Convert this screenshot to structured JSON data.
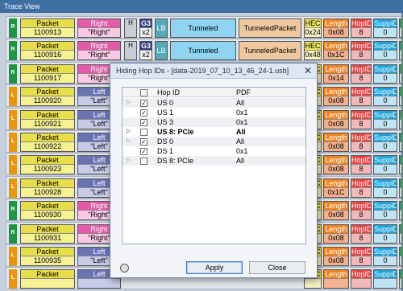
{
  "window": {
    "title": "Trace View"
  },
  "rows": [
    {
      "dir": "R",
      "packet": "1100913",
      "direction": "Right",
      "direction_val": "\"Right\"",
      "hv": "H",
      "g3": "G3",
      "g3_val": "x2",
      "lb": "LB",
      "tunneled": "Tunneled",
      "tunneled_packet": "TunneledPacket",
      "hec_h": "HEC",
      "hec": "0x24",
      "len_h": "Length",
      "len": "0x08",
      "hop_h": "HopID",
      "hop": "8",
      "sup_h": "SuppID",
      "sup": "0",
      "pl_h": "P",
      "pl": ""
    },
    {
      "dir": "R",
      "packet": "1100916",
      "direction": "Right",
      "direction_val": "\"Right\"",
      "hv": "H",
      "g3": "G3",
      "g3_val": "x2",
      "lb": "LB",
      "tunneled": "Tunneled",
      "tunneled_packet": "TunneledPacket",
      "hec_h": "HEC",
      "hec": "0x48",
      "len_h": "Length",
      "len": "0x1C",
      "hop_h": "HopID",
      "hop": "8",
      "sup_h": "SuppID",
      "sup": "0",
      "pl_h": "P",
      "pl": ""
    },
    {
      "dir": "R",
      "packet": "1100917",
      "direction": "Right",
      "direction_val": "\"Right\"",
      "hv": "",
      "g3": "",
      "g3_val": "",
      "lb": "",
      "tunneled": "",
      "tunneled_packet": "",
      "hec_h": "HEC",
      "hec": "",
      "len_h": "Length",
      "len": "0x14",
      "hop_h": "HopID",
      "hop": "8",
      "sup_h": "SuppID",
      "sup": "0",
      "pl_h": "P",
      "pl": ""
    },
    {
      "dir": "L",
      "packet": "1100920",
      "direction": "Left",
      "direction_val": "\"Left\"",
      "hv": "",
      "g3": "",
      "g3_val": "",
      "lb": "",
      "tunneled": "",
      "tunneled_packet": "",
      "hec_h": "HEC",
      "hec": "",
      "len_h": "Length",
      "len": "0x08",
      "hop_h": "HopID",
      "hop": "8",
      "sup_h": "SuppID",
      "sup": "0",
      "pl_h": "P",
      "pl": ""
    },
    {
      "dir": "L",
      "packet": "1100921",
      "direction": "Left",
      "direction_val": "\"Left\"",
      "hv": "",
      "g3": "",
      "g3_val": "",
      "lb": "",
      "tunneled": "",
      "tunneled_packet": "",
      "hec_h": "HEC",
      "hec": "",
      "len_h": "Length",
      "len": "0x08",
      "hop_h": "HopID",
      "hop": "8",
      "sup_h": "SuppID",
      "sup": "0",
      "pl_h": "P",
      "pl": ""
    },
    {
      "dir": "L",
      "packet": "1100922",
      "direction": "Left",
      "direction_val": "\"Left\"",
      "hv": "",
      "g3": "",
      "g3_val": "",
      "lb": "",
      "tunneled": "",
      "tunneled_packet": "",
      "hec_h": "HEC",
      "hec": "",
      "len_h": "Length",
      "len": "0x08",
      "hop_h": "HopID",
      "hop": "8",
      "sup_h": "SuppID",
      "sup": "0",
      "pl_h": "P",
      "pl": ""
    },
    {
      "dir": "L",
      "packet": "1100923",
      "direction": "Left",
      "direction_val": "\"Left\"",
      "hv": "",
      "g3": "",
      "g3_val": "",
      "lb": "",
      "tunneled": "",
      "tunneled_packet": "",
      "hec_h": "HEC",
      "hec": "",
      "len_h": "Length",
      "len": "0x08",
      "hop_h": "HopID",
      "hop": "8",
      "sup_h": "SuppID",
      "sup": "0",
      "pl_h": "P",
      "pl": ""
    },
    {
      "dir": "L",
      "packet": "1100928",
      "direction": "Left",
      "direction_val": "\"Left\"",
      "hv": "",
      "g3": "",
      "g3_val": "",
      "lb": "",
      "tunneled": "",
      "tunneled_packet": "",
      "hec_h": "HEC",
      "hec": "",
      "len_h": "Length",
      "len": "0x1C",
      "hop_h": "HopID",
      "hop": "8",
      "sup_h": "SuppID",
      "sup": "0",
      "pl_h": "P",
      "pl": ""
    },
    {
      "dir": "R",
      "packet": "1100930",
      "direction": "Right",
      "direction_val": "\"Right\"",
      "hv": "",
      "g3": "",
      "g3_val": "",
      "lb": "",
      "tunneled": "",
      "tunneled_packet": "",
      "hec_h": "HEC",
      "hec": "",
      "len_h": "Length",
      "len": "0x08",
      "hop_h": "HopID",
      "hop": "8",
      "sup_h": "SuppID",
      "sup": "0",
      "pl_h": "P",
      "pl": ""
    },
    {
      "dir": "R",
      "packet": "1100931",
      "direction": "Right",
      "direction_val": "\"Right\"",
      "hv": "",
      "g3": "",
      "g3_val": "",
      "lb": "",
      "tunneled": "",
      "tunneled_packet": "",
      "hec_h": "HEC",
      "hec": "",
      "len_h": "Length",
      "len": "0x08",
      "hop_h": "HopID",
      "hop": "8",
      "sup_h": "SuppID",
      "sup": "0",
      "pl_h": "P",
      "pl": ""
    },
    {
      "dir": "L",
      "packet": "1100935",
      "direction": "Left",
      "direction_val": "\"Left\"",
      "hv": "",
      "g3": "",
      "g3_val": "",
      "lb": "",
      "tunneled": "",
      "tunneled_packet": "",
      "hec_h": "HEC",
      "hec": "",
      "len_h": "Length",
      "len": "0x08",
      "hop_h": "HopID",
      "hop": "8",
      "sup_h": "SuppID",
      "sup": "0",
      "pl_h": "P",
      "pl": ""
    },
    {
      "dir": "L",
      "packet": "",
      "direction": "Left",
      "direction_val": "",
      "hv": "",
      "g3": "",
      "g3_val": "",
      "lb": "",
      "tunneled": "",
      "tunneled_packet": "",
      "hec_h": "HEC",
      "hec": "",
      "len_h": "Length",
      "len": "",
      "hop_h": "HopID",
      "hop": "",
      "sup_h": "SuppID",
      "sup": "",
      "pl_h": "P",
      "pl": ""
    }
  ],
  "dialog": {
    "title": "Hiding Hop IDs - [data-2019_07_10_13_46_24-1.usb]",
    "close_glyph": "✕",
    "col_hop": "Hop ID",
    "col_pdf": "PDF",
    "items": [
      {
        "expander": "▷",
        "checked": "✓",
        "name": "US 0",
        "pdf": "All",
        "bold": false
      },
      {
        "expander": "",
        "checked": "✓",
        "name": "US 1",
        "pdf": "0x1",
        "bold": false
      },
      {
        "expander": "",
        "checked": "✓",
        "name": "US 3",
        "pdf": "0x1",
        "bold": false
      },
      {
        "expander": "▷",
        "checked": "",
        "name": "US 8: PCIe",
        "pdf": "All",
        "bold": true
      },
      {
        "expander": "▷",
        "checked": "✓",
        "name": "DS 0",
        "pdf": "All",
        "bold": false
      },
      {
        "expander": "",
        "checked": "✓",
        "name": "DS 1",
        "pdf": "0x1",
        "bold": false
      },
      {
        "expander": "▷",
        "checked": "",
        "name": "DS 8: PCIe",
        "pdf": "All",
        "bold": false
      }
    ],
    "apply_label": "Apply",
    "close_label": "Close"
  }
}
